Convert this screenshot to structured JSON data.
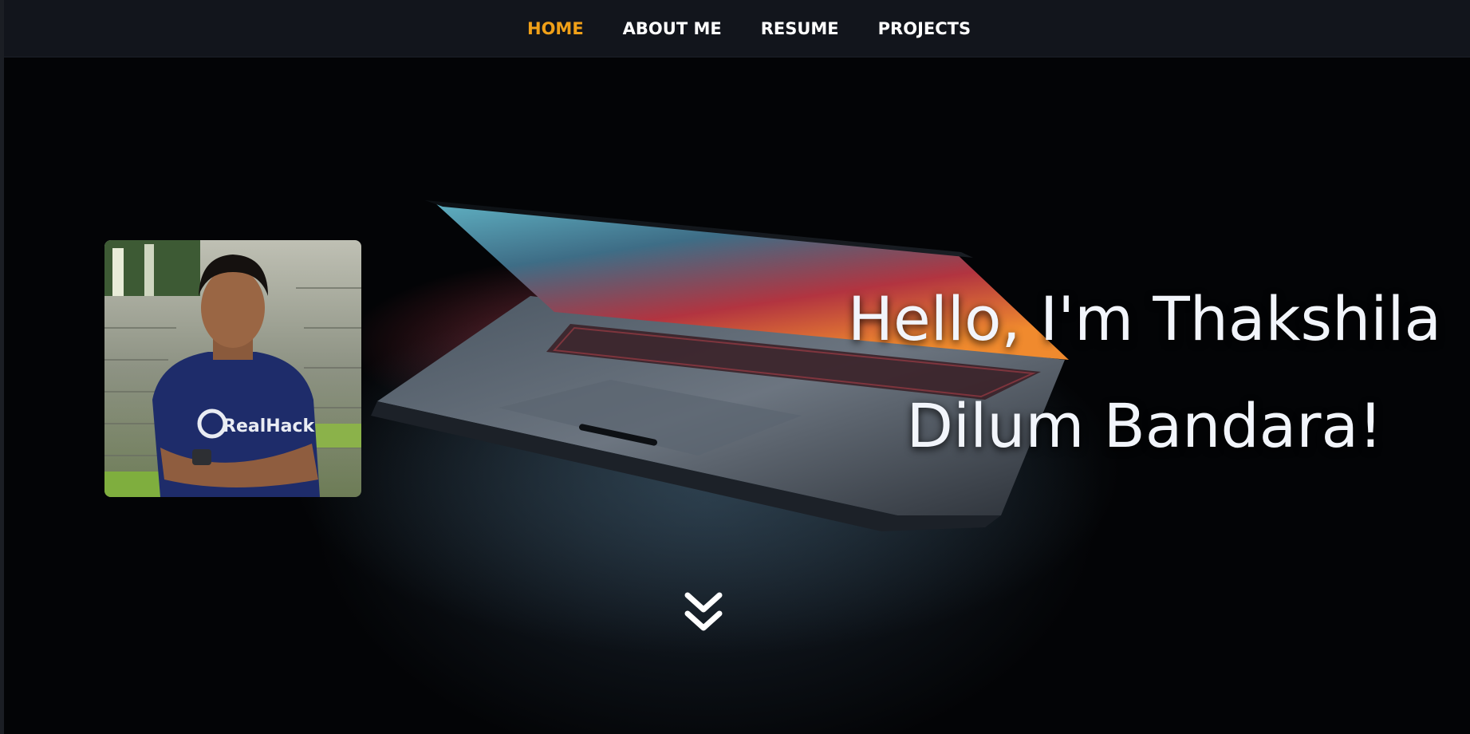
{
  "nav": {
    "items": [
      {
        "label": "HOME",
        "active": true
      },
      {
        "label": "ABOUT ME",
        "active": false
      },
      {
        "label": "RESUME",
        "active": false
      },
      {
        "label": "PROJECTS",
        "active": false
      }
    ]
  },
  "hero": {
    "headline_line1": "Hello, I'm Thakshila",
    "headline_line2": "Dilum Bandara!",
    "portrait_shirt_text": "RealHack",
    "scroll_icon": "double-chevron-down-icon"
  },
  "colors": {
    "accent": "#f0a018",
    "navbar_bg": "#12151c",
    "text": "#ffffff"
  }
}
